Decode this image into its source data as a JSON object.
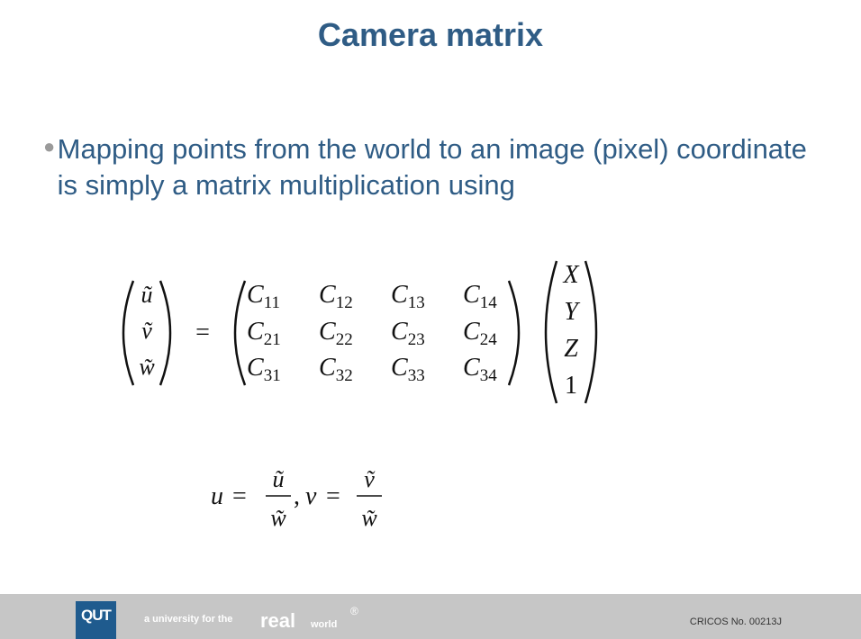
{
  "slide": {
    "title": "Camera matrix",
    "bullet": "Mapping points from the world to an image (pixel) coordinate is simply a matrix multiplication using"
  },
  "equation1": {
    "lhs": [
      "ũ",
      "ṽ",
      "w̃"
    ],
    "eq": "=",
    "c_rows": [
      [
        "C",
        "11",
        "C",
        "12",
        "C",
        "13",
        "C",
        "14"
      ],
      [
        "C",
        "21",
        "C",
        "22",
        "C",
        "23",
        "C",
        "24"
      ],
      [
        "C",
        "31",
        "C",
        "32",
        "C",
        "33",
        "C",
        "34"
      ]
    ],
    "c11": "C",
    "c11s": "11",
    "c12": "C",
    "c12s": "12",
    "c13": "C",
    "c13s": "13",
    "c14": "C",
    "c14s": "14",
    "c21": "C",
    "c21s": "21",
    "c22": "C",
    "c22s": "22",
    "c23": "C",
    "c23s": "23",
    "c24": "C",
    "c24s": "24",
    "c31": "C",
    "c31s": "31",
    "c32": "C",
    "c32s": "32",
    "c33": "C",
    "c33s": "33",
    "c34": "C",
    "c34s": "34",
    "rhs": [
      "X",
      "Y",
      "Z",
      "1"
    ]
  },
  "equation2": {
    "u": "u",
    "eq": "=",
    "u_num": "ũ",
    "u_den": "w̃",
    "comma": ",",
    "v": "v",
    "v_num": "ṽ",
    "v_den": "w̃"
  },
  "footer": {
    "logo": "QUT",
    "tagline_small1": "a university for the",
    "tagline_big": "real",
    "tagline_small2": "world",
    "registered": "®",
    "cricos": "CRICOS No. 00213J"
  },
  "colors": {
    "title": "#2f5c85",
    "bullet_text": "#2f5c85",
    "footer_bg": "#c6c6c6",
    "logo_bg": "#1f5b8e"
  }
}
